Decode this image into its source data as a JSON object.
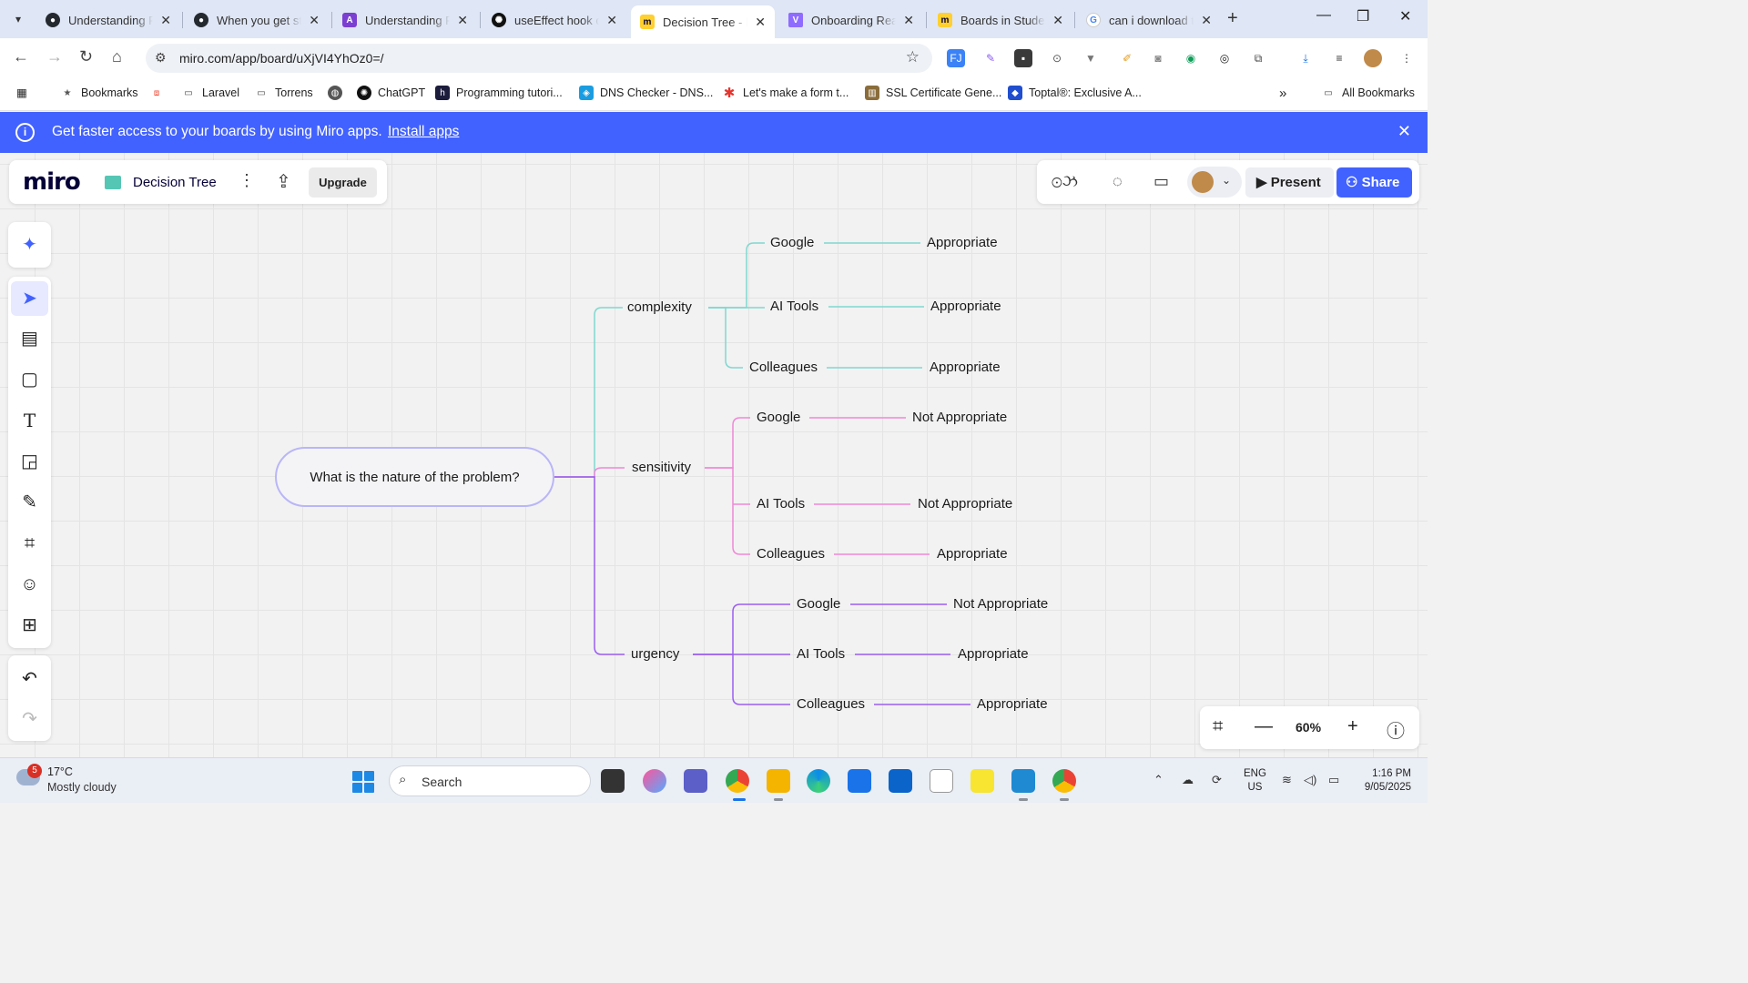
{
  "browser": {
    "tabs": [
      {
        "title": "Understanding R",
        "favicon": "github-icon",
        "color": "#24292f"
      },
      {
        "title": "When you get st",
        "favicon": "github-icon",
        "color": "#24292f"
      },
      {
        "title": "Understanding R",
        "favicon": "app-icon",
        "color": "#7b3fd1"
      },
      {
        "title": "useEffect hook o",
        "favicon": "openai-icon",
        "color": "#111111"
      },
      {
        "title": "Decision Tree - M",
        "favicon": "miro-icon",
        "color": "#ffd02f"
      },
      {
        "title": "Onboarding Rea",
        "favicon": "vercel-icon",
        "color": "#8f6cff"
      },
      {
        "title": "Boards in Studer",
        "favicon": "miro-icon",
        "color": "#ffd02f"
      },
      {
        "title": "can i download t",
        "favicon": "google-icon",
        "color": "#4285f4"
      }
    ],
    "url": "miro.com/app/board/uXjVI4YhOz0=/",
    "bookmarks": [
      {
        "label": "Bookmarks",
        "icon": "star-icon"
      },
      {
        "label": "",
        "icon": "laravel-icon"
      },
      {
        "label": "Laravel",
        "icon": "folder-icon"
      },
      {
        "label": "Torrens",
        "icon": "folder-icon"
      },
      {
        "label": "",
        "icon": "globe-icon"
      },
      {
        "label": "ChatGPT",
        "icon": "openai-icon"
      },
      {
        "label": "Programming tutori...",
        "icon": "h-icon"
      },
      {
        "label": "DNS Checker - DNS...",
        "icon": "shield-icon"
      },
      {
        "label": "Let's make a form t...",
        "icon": "asterisk-icon"
      },
      {
        "label": "SSL Certificate Gene...",
        "icon": "ssl-icon"
      },
      {
        "label": "Toptal®: Exclusive A...",
        "icon": "toptal-icon"
      }
    ],
    "all_bookmarks": "All Bookmarks"
  },
  "banner": {
    "message": "Get faster access to your boards by using Miro apps.",
    "link": "Install apps"
  },
  "board": {
    "logo": "miro",
    "name": "Decision Tree",
    "upgrade": "Upgrade",
    "present": "Present",
    "share": "Share",
    "zoom": "60%"
  },
  "mindmap": {
    "root": "What is the nature of the problem?",
    "branches": [
      {
        "label": "complexity",
        "color": "#7fd8cf",
        "children": [
          {
            "label": "Google",
            "outcome": "Appropriate"
          },
          {
            "label": "AI Tools",
            "outcome": "Appropriate"
          },
          {
            "label": "Colleagues",
            "outcome": "Appropriate"
          }
        ]
      },
      {
        "label": "sensitivity",
        "color": "#f088d8",
        "children": [
          {
            "label": "Google",
            "outcome": "Not Appropriate"
          },
          {
            "label": "AI Tools",
            "outcome": "Not Appropriate"
          },
          {
            "label": "Colleagues",
            "outcome": "Appropriate"
          }
        ]
      },
      {
        "label": "urgency",
        "color": "#9b5cf0",
        "children": [
          {
            "label": "Google",
            "outcome": "Not Appropriate"
          },
          {
            "label": "AI Tools",
            "outcome": "Appropriate"
          },
          {
            "label": "Colleagues",
            "outcome": "Appropriate"
          }
        ]
      }
    ]
  },
  "taskbar": {
    "weather_temp": "17°C",
    "weather_desc": "Mostly cloudy",
    "weather_badge": "5",
    "search": "Search",
    "lang_top": "ENG",
    "lang_bottom": "US",
    "time": "1:16 PM",
    "date": "9/05/2025"
  }
}
